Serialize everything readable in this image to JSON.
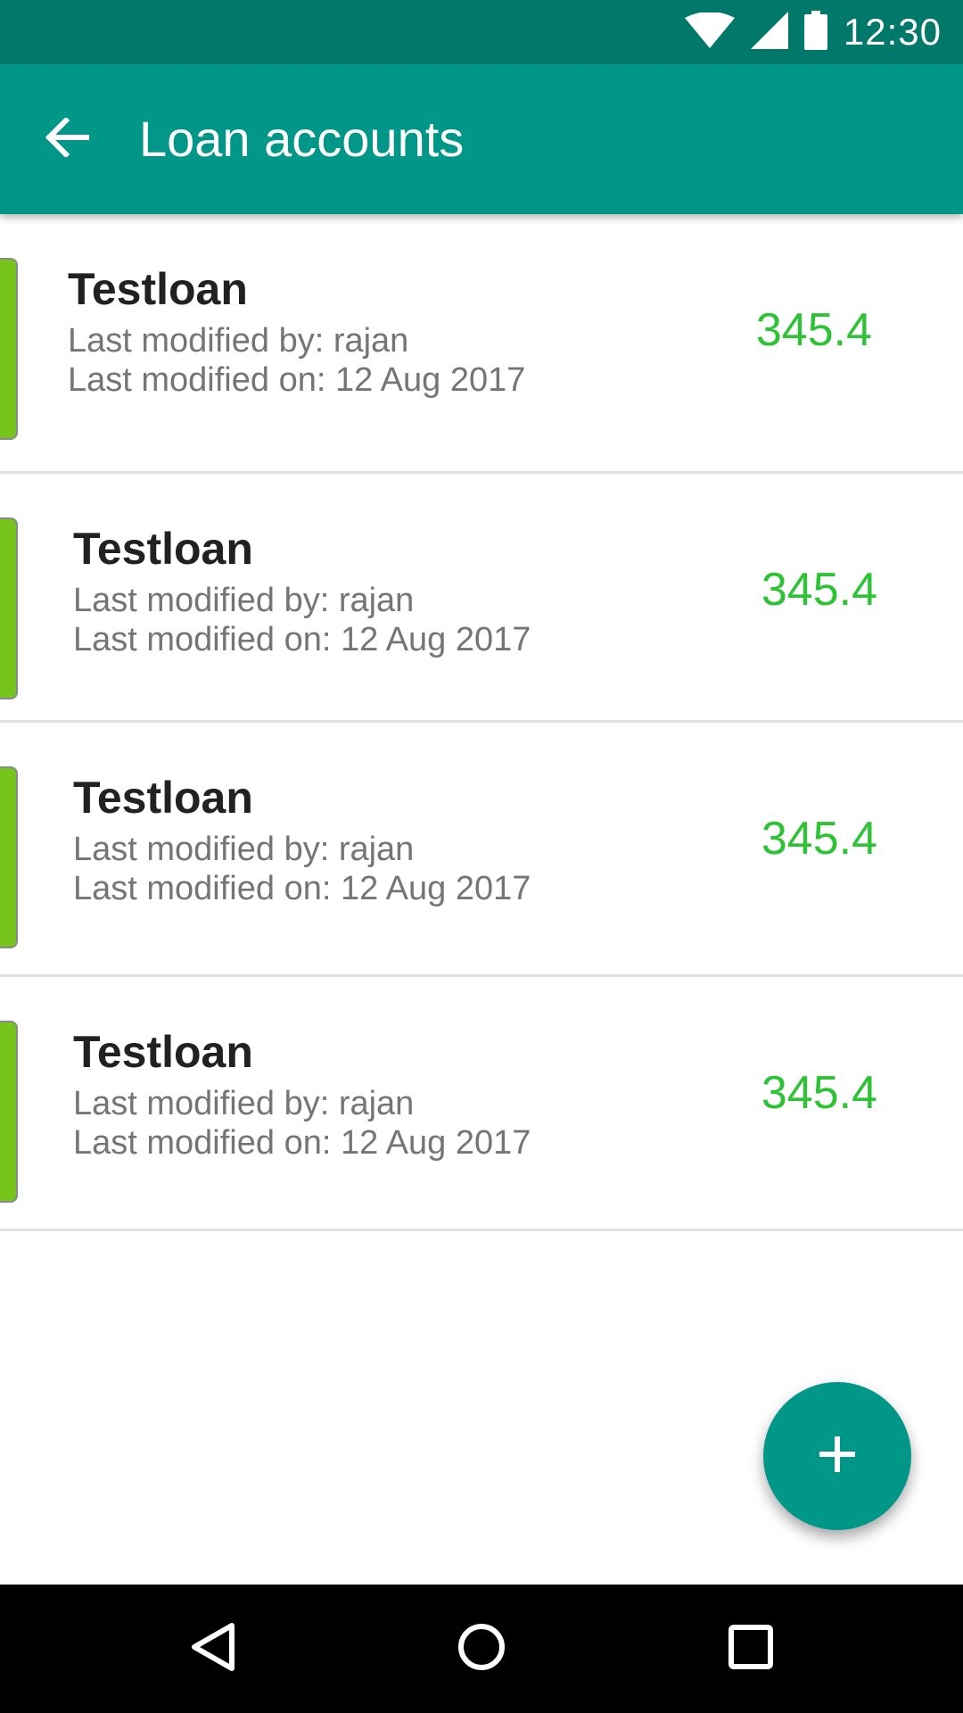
{
  "status_bar": {
    "time": "12:30",
    "icons": [
      "wifi-icon",
      "signal-icon",
      "battery-icon"
    ]
  },
  "app_bar": {
    "title": "Loan accounts",
    "back_icon": "arrow-left-icon"
  },
  "loans": [
    {
      "name": "Testloan",
      "modified_by": "Last modified by: rajan",
      "modified_on": "Last modified on: 12 Aug 2017",
      "amount": "345.4"
    },
    {
      "name": "Testloan",
      "modified_by": "Last modified by: rajan",
      "modified_on": "Last modified on: 12 Aug 2017",
      "amount": "345.4"
    },
    {
      "name": "Testloan",
      "modified_by": "Last modified by: rajan",
      "modified_on": "Last modified on: 12 Aug 2017",
      "amount": "345.4"
    },
    {
      "name": "Testloan",
      "modified_by": "Last modified by: rajan",
      "modified_on": "Last modified on: 12 Aug 2017",
      "amount": "345.4"
    }
  ],
  "fab": {
    "icon": "plus-icon"
  },
  "nav_bar": {
    "icons": [
      "back-triangle-icon",
      "home-circle-icon",
      "recents-square-icon"
    ]
  },
  "colors": {
    "status_bar": "#00796b",
    "app_bar": "#009688",
    "accent": "#009688",
    "amount_green": "#2ec236",
    "status_strip_green": "#76c41c"
  }
}
